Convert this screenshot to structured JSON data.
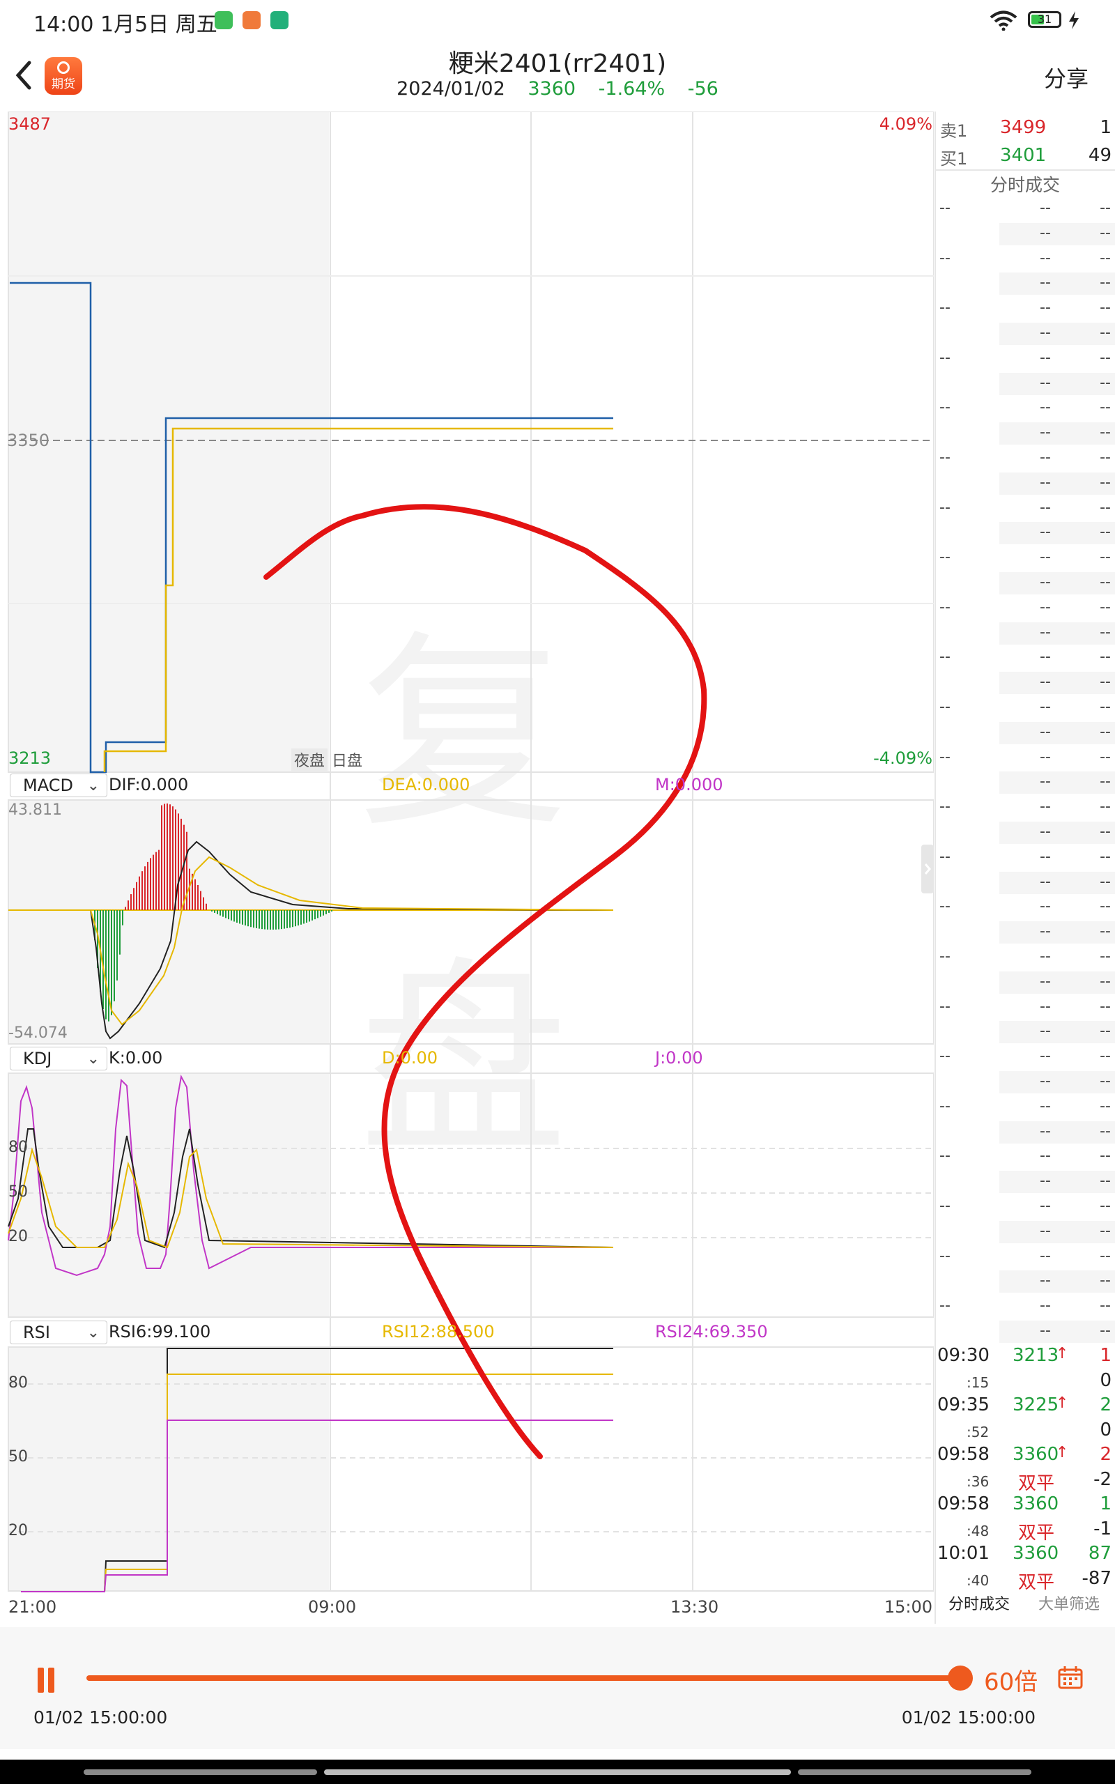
{
  "status": {
    "time": "14:00",
    "date": "1月5日 周五",
    "battery": "31"
  },
  "header": {
    "back": "‹",
    "app_logo_text": "期货",
    "title": "粳米2401(rr2401)",
    "date": "2024/01/02",
    "price": "3360",
    "change_pct": "-1.64%",
    "change": "-56",
    "share": "分享"
  },
  "main_chart": {
    "y_max": "3487",
    "y_min": "3213",
    "y_mid": "3350",
    "pct_max": "4.09%",
    "pct_min": "-4.09%",
    "session_night": "夜盘",
    "session_day": "日盘"
  },
  "watermark": [
    "复",
    "盘"
  ],
  "macd": {
    "selector": "MACD",
    "dif": "DIF:0.000",
    "dea": "DEA:0.000",
    "m": "M:0.000",
    "y_max": "43.811",
    "y_min": "-54.074"
  },
  "kdj": {
    "selector": "KDJ",
    "k": "K:0.00",
    "d": "D:0.00",
    "j": "J:0.00",
    "levels": [
      "80",
      "50",
      "20"
    ]
  },
  "rsi": {
    "selector": "RSI",
    "rsi6": "RSI6:99.100",
    "rsi12": "RSI12:88.500",
    "rsi24": "RSI24:69.350",
    "levels": [
      "80",
      "50",
      "20"
    ]
  },
  "x_axis": [
    "21:00",
    "09:00",
    "13:30",
    "15:00"
  ],
  "order_book": {
    "sell": {
      "label": "卖1",
      "price": "3499",
      "volume": "1"
    },
    "buy": {
      "label": "买1",
      "price": "3401",
      "volume": "49"
    }
  },
  "tick_panel": {
    "title": "分时成交",
    "empty": "--",
    "trades": [
      {
        "time": "09:30",
        "price": "3213",
        "arrow": "↑",
        "volume": "1",
        "color": "red"
      },
      {
        "time": ":15",
        "price": "",
        "arrow": "",
        "volume": "0",
        "color": "black"
      },
      {
        "time": "09:35",
        "price": "3225",
        "arrow": "↑",
        "volume": "2",
        "color": "green"
      },
      {
        "time": ":52",
        "price": "",
        "arrow": "",
        "volume": "0",
        "color": "black"
      },
      {
        "time": "09:58",
        "price": "3360",
        "arrow": "↑",
        "volume": "2",
        "color": "red"
      },
      {
        "time": ":36",
        "price": "双平",
        "arrow": "",
        "volume": "-2",
        "color": "black"
      },
      {
        "time": "09:58",
        "price": "3360",
        "arrow": "",
        "volume": "1",
        "color": "green"
      },
      {
        "time": ":48",
        "price": "双平",
        "arrow": "",
        "volume": "-1",
        "color": "black"
      },
      {
        "time": "10:01",
        "price": "3360",
        "arrow": "",
        "volume": "87",
        "color": "green"
      },
      {
        "time": ":40",
        "price": "双平",
        "arrow": "",
        "volume": "-87",
        "color": "black"
      }
    ],
    "tabs": [
      "分时成交",
      "大单筛选"
    ]
  },
  "player": {
    "speed": "60倍",
    "start_time": "01/02 15:00:00",
    "end_time": "01/02 15:00:00",
    "progress": 1.0
  },
  "colors": {
    "accent": "#ee5a1e",
    "up": "#d9262b",
    "down": "#1f9d3b",
    "price_line": "#1f5fa8",
    "avg_line": "#e6b800",
    "magenta": "#c136c7"
  }
}
